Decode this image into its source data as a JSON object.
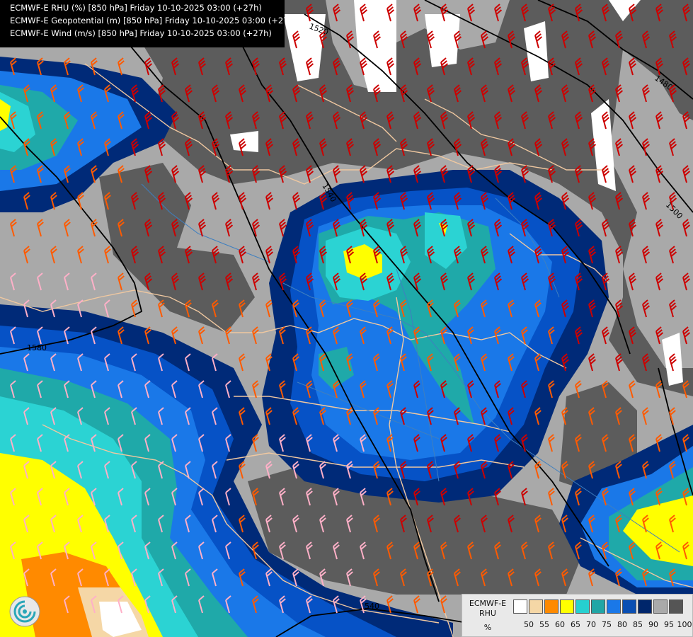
{
  "header": {
    "lines": [
      "ECMWF-E RHU (%) [850 hPa] Friday 10-10-2025 03:00 (+27h)",
      "ECMWF-E Geopotential (m) [850 hPa] Friday 10-10-2025 03:00 (+27h)",
      "ECMWF-E Wind (m/s) [850 hPa] Friday 10-10-2025 03:00 (+27h)"
    ]
  },
  "contour_labels": [
    "1520",
    "1480",
    "1540",
    "1500",
    "1580",
    "1540"
  ],
  "legend": {
    "title_line1": "ECMWF-E",
    "title_line2": "RHU",
    "unit": "%",
    "ticks": [
      "50",
      "55",
      "60",
      "65",
      "70",
      "75",
      "80",
      "85",
      "90",
      "95",
      "100"
    ],
    "colors": [
      "#ffffff",
      "#f5d7a6",
      "#ff8a00",
      "#ffff00",
      "#26d0d0",
      "#21a6a6",
      "#1a78e8",
      "#0a4fb3",
      "#00266b",
      "#aaaaaa",
      "#555555"
    ]
  },
  "colors": {
    "rhu_95_100": "#5c5c5c",
    "rhu_90_95": "#a9a9a9",
    "rhu_85_90": "#002a78",
    "rhu_80_85": "#0652c6",
    "rhu_75_80": "#1a7ae8",
    "rhu_70_75": "#1fa9a9",
    "rhu_65_70": "#2bd3d3",
    "rhu_60_65": "#ffff00",
    "rhu_55_60": "#ff8a00",
    "rhu_50_55": "#f5d7a6",
    "border": "#f0c8a0",
    "river": "#3f7fbf",
    "wind_strong": "#cc0000",
    "wind_medium": "#ff5a00",
    "wind_weak": "#ffb0c8",
    "contour": "#000000"
  }
}
